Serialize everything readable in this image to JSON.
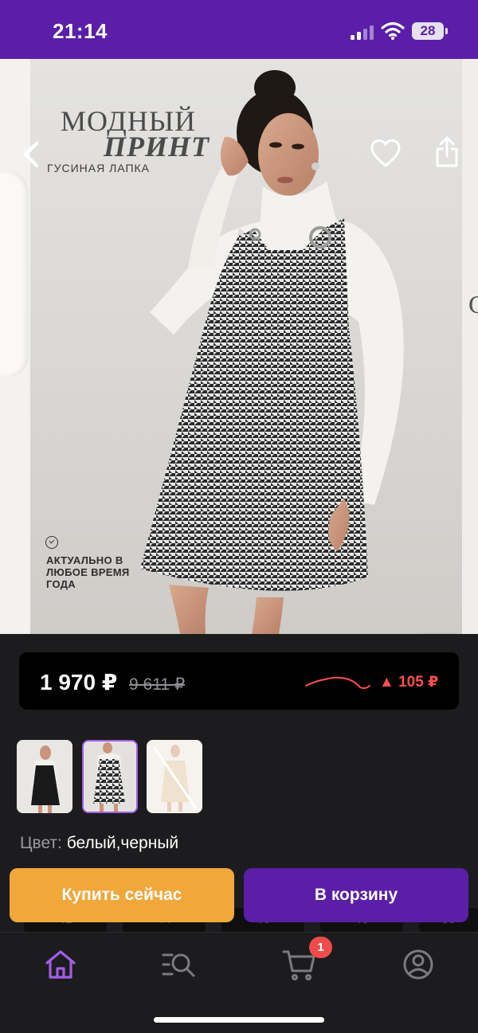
{
  "status_bar": {
    "time": "21:14",
    "battery_level": "28"
  },
  "hero": {
    "headline_line1": "МОДНЫЙ",
    "headline_line2": "ПРИНТ",
    "subheadline": "ГУСИНАЯ ЛАПКА",
    "feature_text": "АКТУАЛЬНО В ЛЮБОЕ ВРЕМЯ ГОДА",
    "icons": {
      "back": "chevron-left-icon",
      "favorite": "heart-icon",
      "share": "share-icon",
      "visual_search": "image-search-icon",
      "feature": "check-circle-icon"
    }
  },
  "price": {
    "current": "1 970 ₽",
    "old": "9 611 ₽",
    "change": "▲ 105 ₽",
    "trend_color": "#ff4f4f"
  },
  "gallery": {
    "thumbnails": [
      {
        "variant": "black pinafore dress",
        "selected": false
      },
      {
        "variant": "houndstooth pinafore dress",
        "selected": true
      },
      {
        "variant": "beige dress, unavailable",
        "selected": false
      }
    ]
  },
  "product": {
    "color_label": "Цвет:",
    "color_value": "белый,черный"
  },
  "actions": {
    "buy_now": "Купить сейчас",
    "add_to_cart": "В корзину"
  },
  "size_strip": [
    "42",
    "44",
    "46",
    "48",
    "50"
  ],
  "tab_bar": {
    "items": [
      {
        "name": "home",
        "icon": "home-icon",
        "active": true
      },
      {
        "name": "catalog",
        "icon": "search-list-icon",
        "active": false
      },
      {
        "name": "cart",
        "icon": "cart-icon",
        "active": false
      },
      {
        "name": "profile",
        "icon": "user-icon",
        "active": false
      }
    ],
    "cart_badge": "1"
  },
  "colors": {
    "accent": "#5a1ea8",
    "accent_light": "#a35de6",
    "buy_button": "#f2a73b",
    "badge": "#f04b4b",
    "background": "#1c1c1e"
  }
}
